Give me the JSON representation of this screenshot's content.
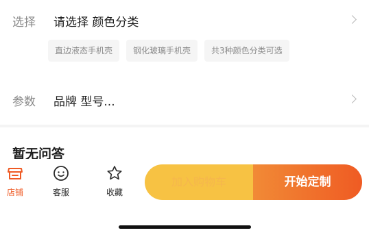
{
  "select_row": {
    "label": "选择",
    "value": "请选择 颜色分类",
    "chips": [
      "直边液态手机壳",
      "钢化玻璃手机壳",
      "共3种颜色分类可选"
    ]
  },
  "params_row": {
    "label": "参数",
    "value": "品牌 型号..."
  },
  "qa": {
    "title": "暂无问答"
  },
  "bottom_bar": {
    "store_label": "店铺",
    "service_label": "客服",
    "favorite_label": "收藏",
    "add_cart_label": "加入购物车",
    "customize_label": "开始定制"
  },
  "colors": {
    "accent": "#ef5a24",
    "cart_button": "#f7c243"
  }
}
